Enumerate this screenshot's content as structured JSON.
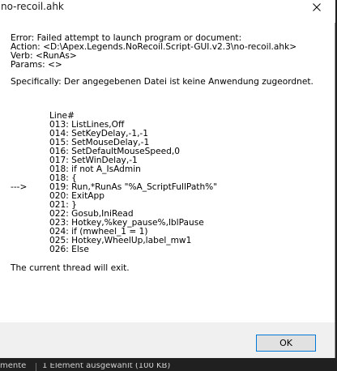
{
  "window": {
    "title": "no-recoil.ahk"
  },
  "message": {
    "error": "Error:  Failed attempt to launch program or document:",
    "action": "Action: <D:\\Apex.Legends.NoRecoil.Script-GUI.v2.3\\no-recoil.ahk>",
    "verb": "Verb: <RunAs>",
    "params": "Params: <>",
    "specifically": "Specifically: Der angegebenen Datei ist keine Anwendung zugeordnet.",
    "code_header": "Line#",
    "code_lines": [
      {
        "text": "013: ListLines,Off",
        "arrow": ""
      },
      {
        "text": "014: SetKeyDelay,-1,-1",
        "arrow": ""
      },
      {
        "text": "015: SetMouseDelay,-1",
        "arrow": ""
      },
      {
        "text": "016: SetDefaultMouseSpeed,0",
        "arrow": ""
      },
      {
        "text": "017: SetWinDelay,-1",
        "arrow": ""
      },
      {
        "text": "018: if not A_IsAdmin",
        "arrow": ""
      },
      {
        "text": "018: {",
        "arrow": ""
      },
      {
        "text": "019: Run,*RunAs \"%A_ScriptFullPath%\"",
        "arrow": "--->"
      },
      {
        "text": "020: ExitApp",
        "arrow": ""
      },
      {
        "text": "021: }",
        "arrow": ""
      },
      {
        "text": "022: Gosub,IniRead",
        "arrow": ""
      },
      {
        "text": "023: Hotkey,%key_pause%,lblPause",
        "arrow": ""
      },
      {
        "text": "024: if (mwheel_1 = 1)",
        "arrow": ""
      },
      {
        "text": "025: Hotkey,WheelUp,label_mw1",
        "arrow": ""
      },
      {
        "text": "026: Else",
        "arrow": ""
      }
    ],
    "thread_exit": "The current thread will exit."
  },
  "buttons": {
    "ok_label": "OK"
  },
  "taskbar": {
    "left_text": "mente",
    "status_text": "1 Element ausgewählt (100 KB)"
  },
  "colors": {
    "dialog_bg": "#ffffff",
    "footer_bg": "#f0f0f0",
    "button_border": "#0078d7",
    "taskbar_bg": "#202020"
  },
  "icons": {
    "close": "close-icon"
  }
}
